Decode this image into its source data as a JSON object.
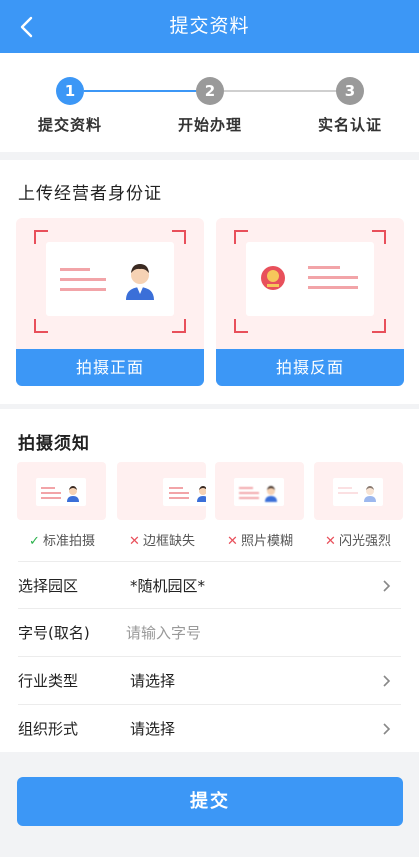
{
  "header": {
    "title": "提交资料"
  },
  "steps": [
    {
      "number": "1",
      "label": "提交资料",
      "state": "active"
    },
    {
      "number": "2",
      "label": "开始办理",
      "state": "pending"
    },
    {
      "number": "3",
      "label": "实名认证",
      "state": "pending"
    }
  ],
  "upload": {
    "title": "上传经营者身份证",
    "front_button": "拍摄正面",
    "back_button": "拍摄反面"
  },
  "notice": {
    "title": "拍摄须知",
    "samples": [
      {
        "label": "标准拍摄",
        "status": "ok"
      },
      {
        "label": "边框缺失",
        "status": "bad"
      },
      {
        "label": "照片模糊",
        "status": "bad"
      },
      {
        "label": "闪光强烈",
        "status": "bad"
      }
    ]
  },
  "form": {
    "park": {
      "label": "选择园区",
      "value": "*随机园区*"
    },
    "name": {
      "label": "字号(取名)",
      "placeholder": "请输入字号"
    },
    "industry": {
      "label": "行业类型",
      "value": "请选择"
    },
    "org": {
      "label": "组织形式",
      "value": "请选择"
    }
  },
  "submit_label": "提交",
  "colors": {
    "primary": "#3c97f6",
    "inactive_step": "#999999",
    "accent_red": "#e8505b",
    "ok_green": "#2bb24c"
  }
}
